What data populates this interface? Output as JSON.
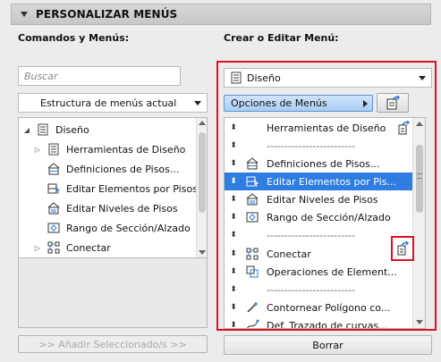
{
  "panel": {
    "title": "PERSONALIZAR MENÚS"
  },
  "left": {
    "heading": "Comandos y Menús:",
    "search_placeholder": "Buscar",
    "view_dropdown": "Estructura de menús actual",
    "tree": [
      {
        "label": "Diseño",
        "expander": "◢",
        "icon": "menu-icon"
      },
      {
        "label": "Herramientas de Diseño",
        "expander": "▷",
        "icon": "menu-icon"
      },
      {
        "label": "Definiciones de Pisos...",
        "expander": "",
        "icon": "floor-definitions-icon"
      },
      {
        "label": "Editar Elementos por Pisos...",
        "expander": "",
        "icon": "edit-elements-by-floor-icon"
      },
      {
        "label": "Editar Niveles de Pisos",
        "expander": "",
        "icon": "floor-levels-icon"
      },
      {
        "label": "Rango de Sección/Alzado",
        "expander": "",
        "icon": "section-range-icon"
      },
      {
        "label": "Conectar",
        "expander": "▷",
        "icon": "connect-icon"
      }
    ],
    "add_button": ">> Añadir Seleccionado/s >>"
  },
  "right": {
    "heading": "Crear o Editar Menú:",
    "menu_dropdown": "Diseño",
    "options_button": "Opciones de Menús",
    "items": [
      {
        "label": "Herramientas de Diseño",
        "icon": "",
        "badge": true
      },
      {
        "label": "-------------------------",
        "icon": "",
        "separator": true
      },
      {
        "label": "Definiciones de Pisos...",
        "icon": "floor-definitions-icon"
      },
      {
        "label": "Editar Elementos por Pis...",
        "icon": "edit-elements-by-floor-icon",
        "selected": true
      },
      {
        "label": "Editar Niveles de Pisos",
        "icon": "floor-levels-icon"
      },
      {
        "label": "Rango de Sección/Alzado",
        "icon": "section-range-icon"
      },
      {
        "label": "-------------------------",
        "icon": "",
        "separator": true
      },
      {
        "label": "Conectar",
        "icon": "connect-icon"
      },
      {
        "label": "Operaciones de Element...",
        "icon": "element-operations-icon"
      },
      {
        "label": "-------------------------",
        "icon": "",
        "separator": true
      },
      {
        "label": "Contornear Polígono co...",
        "icon": "magic-wand-icon"
      },
      {
        "label": "Def. Trazado de curvas...",
        "icon": "curve-trace-icon"
      }
    ],
    "delete_button": "Borrar"
  },
  "colors": {
    "selection": "#2f7de1",
    "highlight_frame": "#e01020",
    "options_button": "#a9cdf4"
  }
}
